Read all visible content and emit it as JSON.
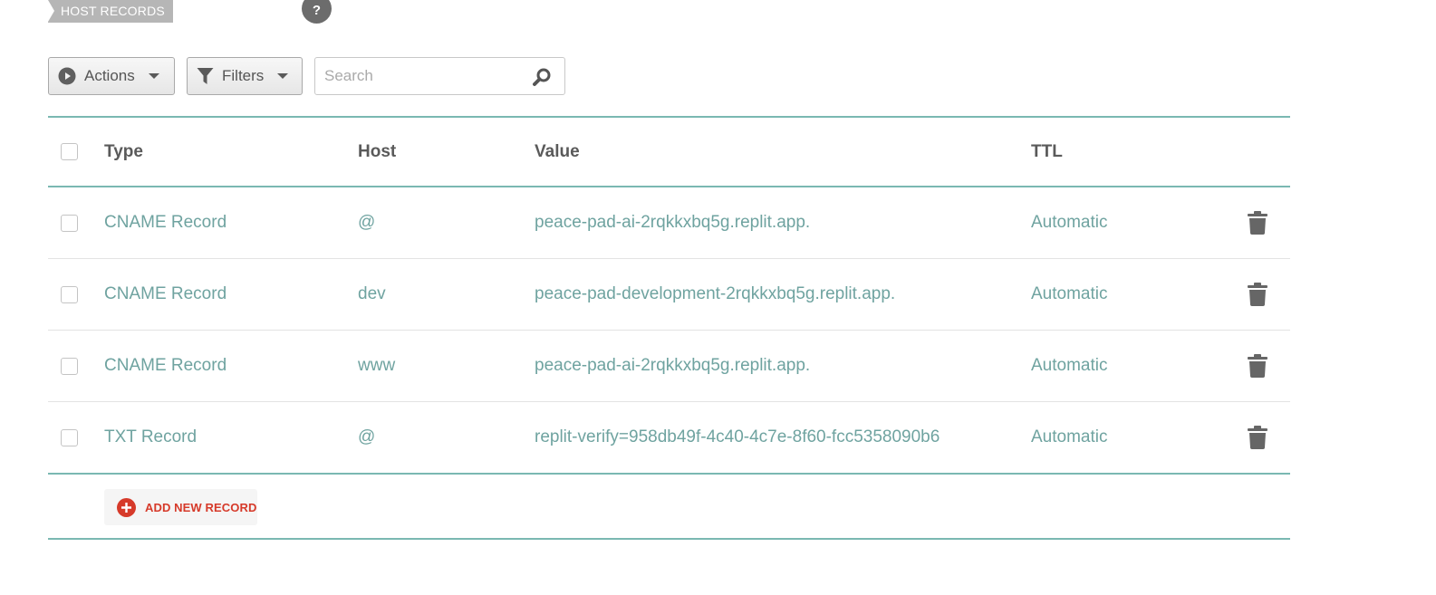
{
  "section": {
    "title": "HOST RECORDS",
    "help_label": "?"
  },
  "toolbar": {
    "actions_label": "Actions",
    "filters_label": "Filters",
    "search_placeholder": "Search",
    "search_value": ""
  },
  "table": {
    "headers": {
      "type": "Type",
      "host": "Host",
      "value": "Value",
      "ttl": "TTL"
    },
    "rows": [
      {
        "type": "CNAME Record",
        "host": "@",
        "value": "peace-pad-ai-2rqkkxbq5g.replit.app.",
        "ttl": "Automatic"
      },
      {
        "type": "CNAME Record",
        "host": "dev",
        "value": "peace-pad-development-2rqkkxbq5g.replit.app.",
        "ttl": "Automatic"
      },
      {
        "type": "CNAME Record",
        "host": "www",
        "value": "peace-pad-ai-2rqkkxbq5g.replit.app.",
        "ttl": "Automatic"
      },
      {
        "type": "TXT Record",
        "host": "@",
        "value": "replit-verify=958db49f-4c40-4c7e-8f60-fcc5358090b6",
        "ttl": "Automatic"
      }
    ]
  },
  "add_record": {
    "label": "ADD NEW RECORD"
  },
  "colors": {
    "accent_teal": "#7ab8b2",
    "link_teal": "#6fa3a0",
    "add_red": "#d63a2a",
    "tag_gray": "#b6b6b6"
  },
  "icons": {
    "help": "question-icon",
    "actions": "play-circle-icon",
    "filters": "funnel-icon",
    "search": "magnifier-icon",
    "delete": "trash-icon",
    "add": "plus-circle-icon"
  }
}
